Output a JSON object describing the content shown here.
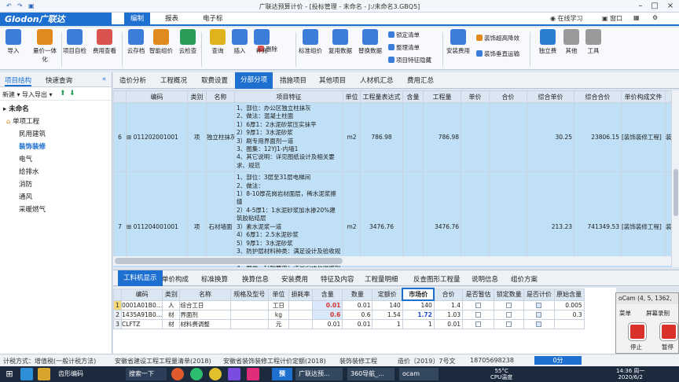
{
  "titlebar": {
    "title": "广联达预算计价 - [投标管理 - 未命名 - J:/未命名3.GBQ5]"
  },
  "menubar": {
    "logo": "Glodon广联达",
    "tabs": [
      "编制",
      "报表",
      "电子标"
    ],
    "online_learning": "在线学习",
    "window": "窗口"
  },
  "ribbon": {
    "buttons": [
      {
        "label": "导入",
        "icon": "import-icon",
        "color": "#3b7dd8"
      },
      {
        "label": "量价一体化",
        "icon": "integration-icon",
        "color": "#e08a1e"
      },
      {
        "label": "项目自检",
        "icon": "project-check-icon",
        "color": "#3b7dd8"
      },
      {
        "label": "费用查看",
        "icon": "fee-view-icon",
        "color": "#d9534f"
      },
      {
        "label": "云存档",
        "icon": "cloud-save-icon",
        "color": "#3b7dd8"
      },
      {
        "label": "智能组价",
        "icon": "smart-pricing-icon",
        "color": "#e08a1e"
      },
      {
        "label": "云检查",
        "icon": "cloud-check-icon",
        "color": "#2a9d5b"
      },
      {
        "label": "查询",
        "icon": "query-icon",
        "color": "#e0b21e"
      },
      {
        "label": "插入",
        "icon": "insert-icon",
        "color": "#3b7dd8"
      },
      {
        "label": "补充",
        "icon": "supplement-icon",
        "color": "#3b7dd8"
      },
      {
        "label": "标准组价",
        "icon": "standard-pricing-icon",
        "color": "#3b7dd8"
      },
      {
        "label": "复用数据",
        "icon": "reuse-data-icon",
        "color": "#3b7dd8"
      },
      {
        "label": "替换数据",
        "icon": "replace-data-icon",
        "color": "#3b7dd8"
      },
      {
        "label": "安装费用",
        "icon": "install-fee-icon",
        "color": "#3b7dd8"
      },
      {
        "label": "独立费",
        "icon": "independent-fee-icon",
        "color": "#2a7fd0"
      },
      {
        "label": "其他",
        "icon": "other-icon",
        "color": "#999999"
      },
      {
        "label": "工具",
        "icon": "tools-icon",
        "color": "#999999"
      }
    ],
    "small": [
      "删除",
      "锁定清单",
      "整理清单",
      "项目特征隐藏",
      "装饰超高降效",
      "装饰垂直运输"
    ]
  },
  "left": {
    "tabs": [
      "项目结构",
      "快速查询"
    ],
    "tools": [
      "新建",
      "导入导出"
    ],
    "root": "未命名",
    "unit": "单项工程",
    "items": [
      "民用建筑",
      "装饰装修",
      "电气",
      "给排水",
      "消防",
      "通风",
      "采暖燃气"
    ]
  },
  "sheet_tabs": [
    "造价分析",
    "工程概况",
    "取费设置",
    "分部分项",
    "措施项目",
    "其他项目",
    "人材机汇总",
    "费用汇总"
  ],
  "grid1": {
    "headers": [
      "",
      "编码",
      "类别",
      "名称",
      "项目特征",
      "单位",
      "工程量表达式",
      "含量",
      "工程量",
      "单价",
      "合价",
      "综合单价",
      "综合合价",
      "单价构成文件",
      ""
    ],
    "rows": [
      {
        "no": "6",
        "code": "011202001001",
        "type": "项",
        "name": "独立柱抹灰",
        "features": [
          "1、部位：办公区独立柱抹灰",
          "2、做法：混凝土柱面",
          "1）6厚1：2水泥砂浆压实抹平",
          "2）9厚1：3水泥砂浆",
          "3）刷专用界面剂一道",
          "3、图集：12YJ1-内墙1",
          "4、其它说明：详见图纸设计及相关要求、规范"
        ],
        "unit": "m2",
        "expr": "786.98",
        "content": "",
        "qty": "786.98",
        "price": "",
        "total": "",
        "comp_price": "30.25",
        "comp_total": "23806.15",
        "file": "[装饰装修工程]",
        "extra": "装饰"
      },
      {
        "no": "7",
        "code": "011204001001",
        "type": "项",
        "name": "石材墙面",
        "features": [
          "1、部位：3层至31层电梯间",
          "2、做法：",
          "1）8-10厚花岗岩材面层，稀水泥浆擦缝",
          "2）4-5厚1：1水泥砂浆加水掺20%建筑胶粘结层",
          "3）素水泥浆一道",
          "4）6厚1：2.5水泥砂浆",
          "5）9厚1：3水泥砂浆",
          "3、防护层材料种类：满足设计及验收规范要求",
          "4、磨光、打蜡要求：满足设计及验收规范要求"
        ],
        "unit": "m2",
        "expr": "3476.76",
        "content": "",
        "qty": "3476.76",
        "price": "",
        "total": "",
        "comp_price": "213.23",
        "comp_total": "741349.53",
        "file": "[装饰装修工程]",
        "extra": "装饰"
      }
    ]
  },
  "bottom_tabs": [
    "工料机显示",
    "单价构成",
    "标准换算",
    "换算信息",
    "安装费用",
    "特征及内容",
    "工程量明细",
    "反查图形工程量",
    "说明信息",
    "组价方案"
  ],
  "grid2": {
    "headers": [
      "",
      "编码",
      "类别",
      "名称",
      "规格及型号",
      "单位",
      "损耗率",
      "含量",
      "数量",
      "定额价",
      "市场价",
      "合价",
      "是否暂估",
      "锁定数量",
      "是否计价",
      "原始含量"
    ],
    "rows": [
      {
        "no": "1",
        "code": "0001A01B0…",
        "type": "人",
        "name": "综合工日",
        "spec": "",
        "unit": "工日",
        "loss": "",
        "content": "0.01",
        "qty": "0.01",
        "quota": "140",
        "market": "140",
        "total": "1.4",
        "temp": false,
        "lock": false,
        "priced": true,
        "orig": "0.005"
      },
      {
        "no": "2",
        "code": "1435A91B0…",
        "type": "材",
        "name": "界面剂",
        "spec": "",
        "unit": "kg",
        "loss": "",
        "content": "0.6",
        "qty": "0.6",
        "quota": "1.54",
        "market": "1.72",
        "total": "1.03",
        "temp": false,
        "lock": false,
        "priced": true,
        "orig": "0.3"
      },
      {
        "no": "3",
        "code": "CLFTZ",
        "type": "材",
        "name": "材料费调整",
        "spec": "",
        "unit": "元",
        "loss": "",
        "content": "0.01",
        "qty": "0.01",
        "quota": "1",
        "market": "1",
        "total": "0.01",
        "temp": false,
        "lock": false,
        "priced": true,
        "orig": ""
      }
    ]
  },
  "ocam": {
    "title": "oCam (4, 5, 1362,",
    "menu1": "菜单",
    "menu2": "屏幕录制",
    "stop": "停止",
    "pause": "暂停"
  },
  "statusbar": {
    "tax": "计税方式：增值税(一般计税方法)",
    "std1": "安徽省建设工程工程量清单(2018)",
    "std2": "安徽省装饰装修工程计价定额(2018)",
    "type": "装饰装修工程",
    "price": "造价〔2019〕7号文",
    "phone": "18705698238",
    "time": "0分"
  },
  "taskbar": {
    "apps": [
      "齿形编码",
      "搜索一下",
      "广联达预...",
      "360导航_...",
      "ocam"
    ],
    "temp": "55°C",
    "cpu": "CPU温度",
    "clock": "14:36 周一",
    "date": "2020/6/2"
  }
}
